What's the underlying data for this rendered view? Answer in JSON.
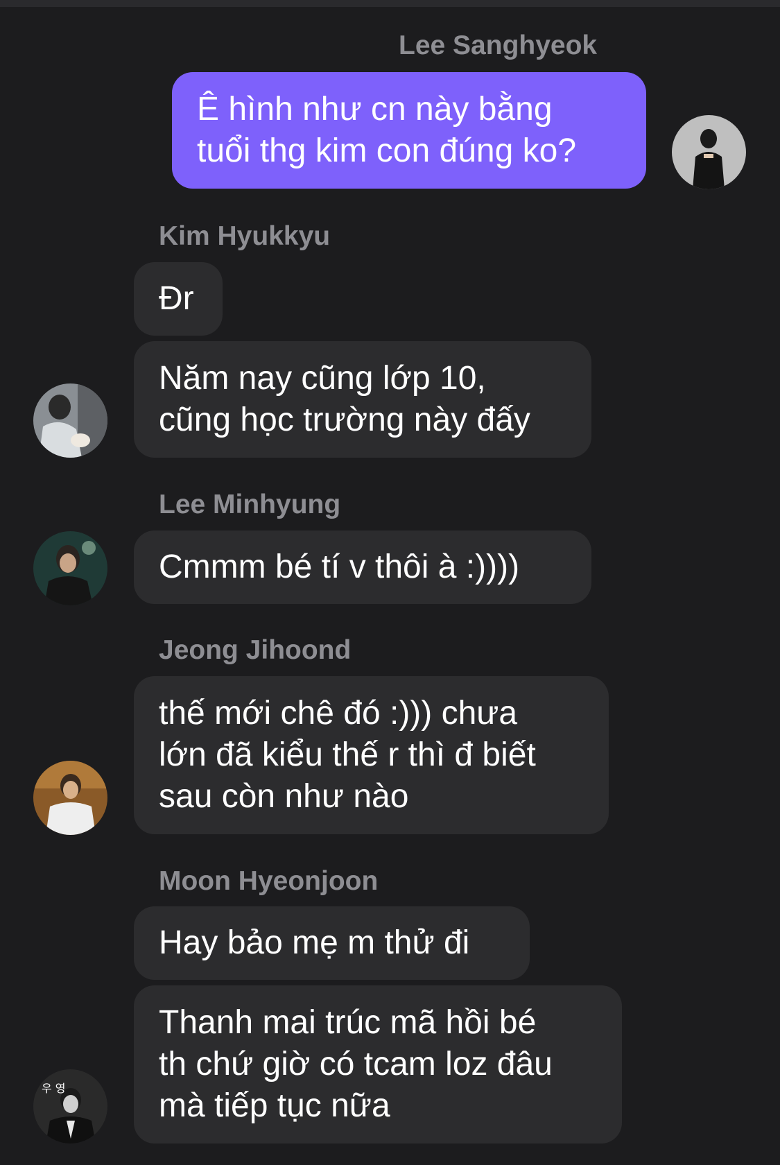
{
  "chat": {
    "messages": [
      {
        "sender": "Lee Sanghyeok",
        "text": "Ê hình như cn này bằng\ntuổi thg kim con đúng ko?"
      },
      {
        "sender": "Kim Hyukkyu",
        "text": "Đr"
      },
      {
        "text": "Năm nay cũng lớp 10,\ncũng học trường này đấy"
      },
      {
        "sender": "Lee Minhyung",
        "text": "Cmmm bé tí v thôi à :))))"
      },
      {
        "sender": "Jeong Jihoond",
        "text": "thế mới chê đó :))) chưa\nlớn đã kiểu thế r thì đ biết\nsau còn như nào"
      },
      {
        "sender": "Moon Hyeonjoon",
        "text": "Hay bảo mẹ m thử đi"
      },
      {
        "text": "Thanh mai trúc mã hồi bé\nth chứ giờ có tcam loz đâu\nmà tiếp tục nữa"
      }
    ],
    "avatars": {
      "moon_overlay_text": "우 영"
    }
  },
  "colors": {
    "background": "#1c1c1e",
    "incoming_bubble": "#2c2c2e",
    "outgoing_bubble": "#7e61fb",
    "sender_name": "#8e8e93"
  }
}
